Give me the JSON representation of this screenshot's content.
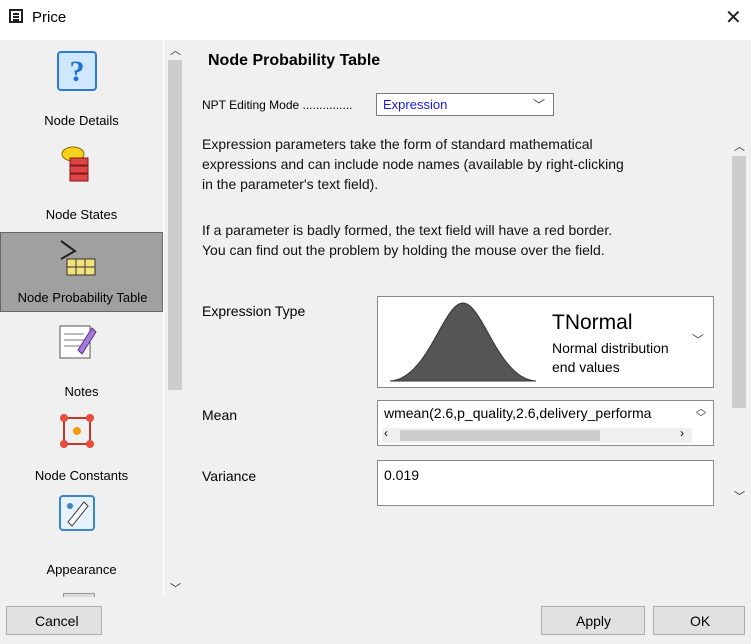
{
  "window": {
    "title": "Price"
  },
  "sidebar": {
    "items": [
      {
        "label": "Node Details",
        "icon": "question-icon"
      },
      {
        "label": "Node States",
        "icon": "node-states-icon"
      },
      {
        "label": "Node Probability Table",
        "icon": "npt-icon"
      },
      {
        "label": "Notes",
        "icon": "notes-icon"
      },
      {
        "label": "Node Constants",
        "icon": "node-constants-icon"
      },
      {
        "label": "Appearance",
        "icon": "appearance-icon"
      }
    ],
    "active_index": 2
  },
  "main": {
    "heading": "Node Probability Table",
    "npt_mode_label": "NPT Editing Mode ...............",
    "npt_mode_value": "Expression",
    "description_1": [
      "Expression parameters take the form of standard mathematical",
      "expressions and can include node names (available by right-clicking",
      "in the parameter's text field)."
    ],
    "description_2": [
      "If a parameter is badly formed, the text field will have a red border.",
      "You can find out the problem by holding the mouse over the field."
    ],
    "expression_type": {
      "label": "Expression Type",
      "name": "TNormal",
      "desc_line1": "Normal distribution",
      "desc_line2": "end values"
    },
    "mean": {
      "label": "Mean",
      "value": "wmean(2.6,p_quality,2.6,delivery_performa"
    },
    "variance": {
      "label": "Variance",
      "value": "0.019"
    }
  },
  "footer": {
    "cancel": "Cancel",
    "apply": "Apply",
    "ok": "OK"
  },
  "colors": {
    "select_text": "#1a1adb",
    "active_item": "#a0a0a0",
    "curve_fill": "#555555"
  }
}
